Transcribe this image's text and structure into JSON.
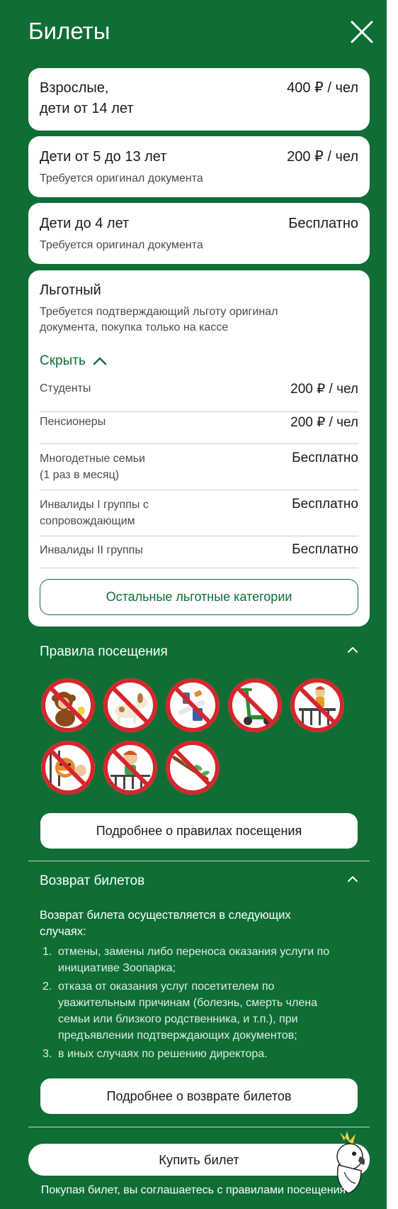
{
  "header": {
    "title": "Билеты",
    "close_icon": "close-icon"
  },
  "tickets": [
    {
      "name": "Взрослые,\nдети от 14 лет",
      "price": "400 ₽ / чел",
      "note": ""
    },
    {
      "name": "Дети от 5 до 13 лет",
      "price": "200 ₽ / чел",
      "note": "Требуется оригинал документа"
    },
    {
      "name": "Дети до 4 лет",
      "price": "Бесплатно",
      "note": "Требуется оригинал документа"
    }
  ],
  "discount": {
    "title": "Льготный",
    "note": "Требуется подтверждающий льготу оригинал документа, покупка только на кассе",
    "toggle_label": "Скрыть",
    "rows": [
      {
        "label": "Студенты",
        "price": "200 ₽ / чел"
      },
      {
        "label": "Пенсионеры",
        "price": "200 ₽ / чел"
      },
      {
        "label": "Многодетные семьи\n(1 раз в месяц)",
        "price": "Бесплатно"
      },
      {
        "label": "Инвалиды I группы с\nсопровождающим",
        "price": "Бесплатно"
      },
      {
        "label": "Инвалиды II группы",
        "price": "Бесплатно"
      }
    ],
    "other_button": "Остальные льготные категории"
  },
  "rules": {
    "title": "Правила посещения",
    "icons": [
      "no-feeding-monkeys-icon",
      "no-pets-icon",
      "no-smoking-icon",
      "no-scooters-icon",
      "no-climbing-fence-icon",
      "no-teasing-animals-icon",
      "no-kids-on-fence-icon",
      "no-breaking-branches-icon"
    ],
    "button": "Подробнее о правилах посещения"
  },
  "refund": {
    "title": "Возврат билетов",
    "intro": "Возврат билета осуществляется в следующих случаях:",
    "items": [
      {
        "num": "1.",
        "text": "отмены, замены либо переноса оказания услуги по инициативе Зоопарка;"
      },
      {
        "num": "2.",
        "text": "отказа от оказания услуг посетителем по уважительным причинам (болезнь, смерть члена семьи или близкого родственника, и т.п.), при предъявлении подтверждающих документов;"
      },
      {
        "num": "3.",
        "text": "в иных случаях по решению директора."
      }
    ],
    "button": "Подробнее о возврате билетов"
  },
  "footer": {
    "buy_button": "Купить билет",
    "agreement": "Покупая билет, вы соглашаетесь с правилами посещения",
    "mascot_icon": "parrot-mascot-icon"
  },
  "colors": {
    "brand_green": "#0e6e35",
    "prohibit_red": "#d6262d",
    "white": "#ffffff"
  }
}
